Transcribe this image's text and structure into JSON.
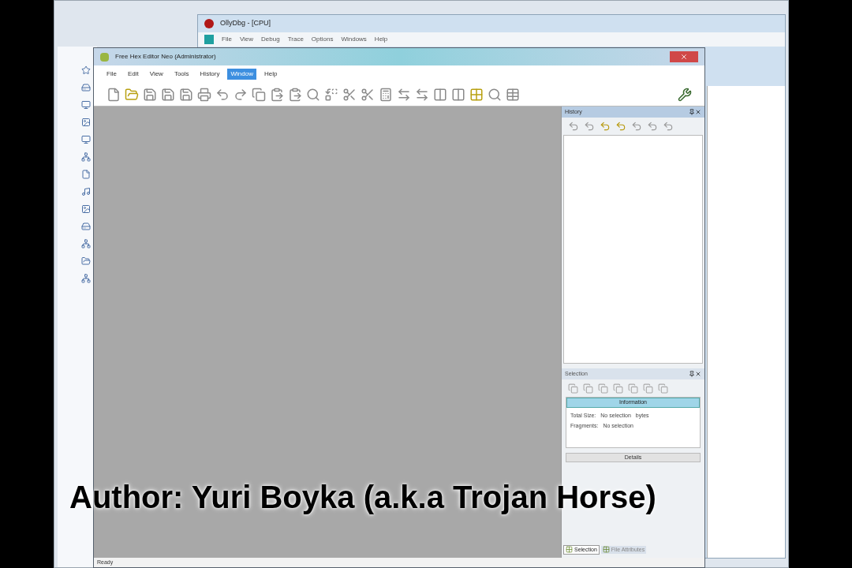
{
  "caption": "Author: Yuri Boyka (a.k.a Trojan Horse)",
  "debugger": {
    "title": "OllyDbg - [CPU]",
    "menu": [
      "File",
      "View",
      "Debug",
      "Trace",
      "Options",
      "Windows",
      "Help"
    ]
  },
  "editor": {
    "title": "Free Hex Editor Neo (Administrator)",
    "menu": [
      {
        "label": "File",
        "selected": false
      },
      {
        "label": "Edit",
        "selected": false
      },
      {
        "label": "View",
        "selected": false
      },
      {
        "label": "Tools",
        "selected": false
      },
      {
        "label": "History",
        "selected": false
      },
      {
        "label": "Window",
        "selected": true
      },
      {
        "label": "Help",
        "selected": false
      }
    ],
    "history_panel": {
      "title": "History"
    },
    "selection_panel": {
      "title": "Selection",
      "section": "Information",
      "rows": [
        {
          "label": "Total Size:",
          "value": "No selection",
          "unit": "bytes"
        },
        {
          "label": "Fragments:",
          "value": "No selection"
        }
      ],
      "details": "Details"
    },
    "bottom_tabs": [
      {
        "label": "Selection",
        "selected": true
      },
      {
        "label": "File Attributes",
        "selected": false
      }
    ],
    "status": "Ready"
  }
}
